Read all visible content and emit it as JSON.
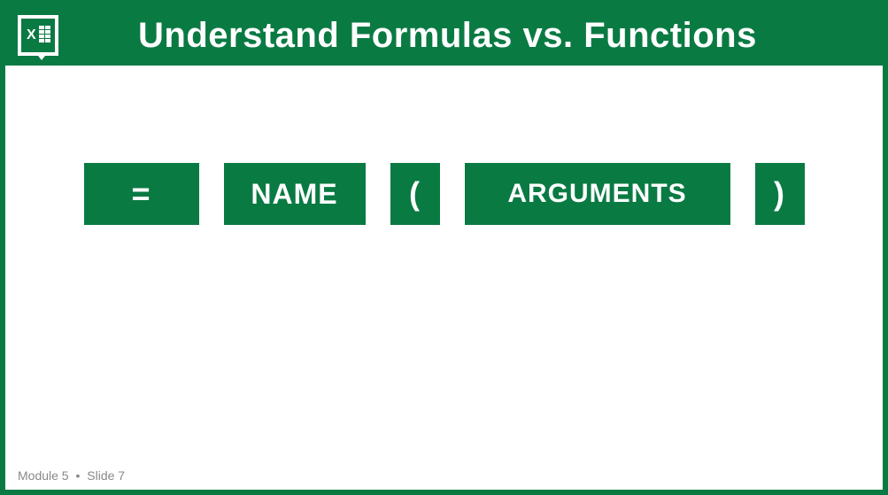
{
  "header": {
    "title": "Understand Formulas vs. Functions"
  },
  "tokens": {
    "equals": "=",
    "name": "NAME",
    "open_paren": "(",
    "arguments": "ARGUMENTS",
    "close_paren": ")"
  },
  "footer": {
    "module": "Module 5",
    "bullet": "•",
    "slide": "Slide 7"
  }
}
